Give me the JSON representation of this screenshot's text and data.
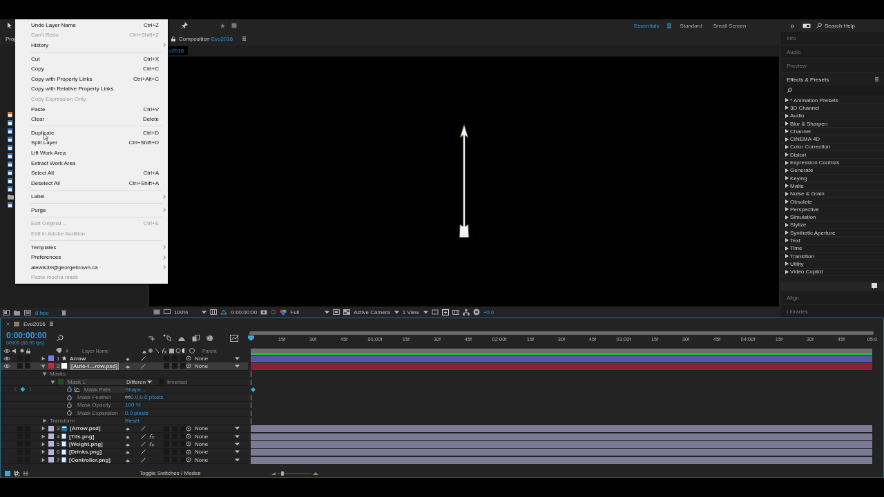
{
  "toolbar": {
    "workspaces": [
      {
        "label": "Essentials",
        "selected": true
      },
      {
        "label": "Standard",
        "selected": false
      },
      {
        "label": "Small Screen",
        "selected": false
      }
    ],
    "overflow": "»",
    "search_placeholder": "Search Help"
  },
  "project_panel": {
    "tab": "Proj",
    "bit_depth": "8 bpc"
  },
  "composition_panel": {
    "title": "Composition",
    "comp_name": "Evo2016",
    "tab": "o2016",
    "zoom": "100%",
    "timecode": "0:00:00:00",
    "resolution": "Full",
    "camera": "Active Camera",
    "views": "1 View",
    "exposure": "+0.0"
  },
  "side_panels": {
    "collapsed_top": [
      "Info",
      "Audio",
      "Preview"
    ],
    "effects": {
      "title": "Effects & Presets",
      "items": [
        "* Animation Presets",
        "3D Channel",
        "Audio",
        "Blur & Sharpen",
        "Channel",
        "CINEMA 4D",
        "Color Correction",
        "Distort",
        "Expression Controls",
        "Generate",
        "Keying",
        "Matte",
        "Noise & Grain",
        "Obsolete",
        "Perspective",
        "Simulation",
        "Stylize",
        "Synthetic Aperture",
        "Text",
        "Time",
        "Transition",
        "Utility",
        "Video Copilot"
      ]
    },
    "collapsed_bottom": [
      "Align",
      "Libraries"
    ]
  },
  "timeline": {
    "tab": "Evo2016",
    "timecode": "0:00:00:00",
    "frame_info": "00000 (60.00 fps)",
    "columns": {
      "number": "#",
      "layer_name": "Layer Name",
      "parent": "Parent"
    },
    "ruler": [
      "15f",
      "30f",
      "45f",
      "01:00f",
      "15f",
      "30f",
      "45f",
      "02:00f",
      "15f",
      "30f",
      "45f",
      "03:00f",
      "15f",
      "30f",
      "45f",
      "04:00f",
      "15f",
      "30f",
      "45f",
      "05:0"
    ],
    "layers": [
      {
        "number": "1",
        "name": "Arrow",
        "kind": "shape",
        "color": "#7b7bea",
        "visible": true,
        "selected": false,
        "expanded": false,
        "fx": false,
        "parent": "None"
      },
      {
        "number": "2",
        "name": "[Auto-t…row.psd]",
        "kind": "solid",
        "color": "#c8283a",
        "visible": true,
        "selected": true,
        "expanded": true,
        "fx": false,
        "parent": "None",
        "children": [
          {
            "label": "Masks",
            "expanded": true,
            "children": [
              {
                "label": "Mask 1",
                "kind": "mask",
                "expanded": true,
                "mode": "Differen",
                "inverted": {
                  "label": "Inverted",
                  "checked": false
                },
                "children": [
                  {
                    "label": "Mask Path",
                    "kind": "path",
                    "value": "Shape...",
                    "keyframed": true
                  },
                  {
                    "label": "Mask Feather",
                    "kind": "feather",
                    "value": "0.0,0.0 pixels",
                    "keyframed": false
                  },
                  {
                    "label": "Mask Opacity",
                    "kind": "property",
                    "value": "100 %",
                    "keyframed": false
                  },
                  {
                    "label": "Mask Expansion",
                    "kind": "property",
                    "value": "0.0 pixels",
                    "keyframed": false
                  }
                ]
              }
            ]
          },
          {
            "label": "Transform",
            "expanded": false,
            "value": "Reset"
          }
        ]
      },
      {
        "number": "3",
        "name": "[Arrow.psd]",
        "kind": "psd",
        "color": "#b9b4da",
        "visible": false,
        "selected": false,
        "expanded": false,
        "fx": false,
        "parent": "None"
      },
      {
        "number": "4",
        "name": "[Tits.png]",
        "kind": "image",
        "color": "#b9b4da",
        "visible": false,
        "selected": false,
        "expanded": false,
        "fx": true,
        "parent": "None"
      },
      {
        "number": "5",
        "name": "[Weight.png]",
        "kind": "image",
        "color": "#b9b4da",
        "visible": false,
        "selected": false,
        "expanded": false,
        "fx": true,
        "parent": "None"
      },
      {
        "number": "6",
        "name": "[Drinks.png]",
        "kind": "image",
        "color": "#b9b4da",
        "visible": false,
        "selected": false,
        "expanded": false,
        "fx": false,
        "parent": "None"
      },
      {
        "number": "7",
        "name": "[Controller.png]",
        "kind": "image",
        "color": "#b9b4da",
        "visible": false,
        "selected": false,
        "expanded": false,
        "fx": false,
        "parent": "None"
      }
    ],
    "footer": "Toggle Switches / Modes"
  },
  "context_menu": {
    "groups": [
      [
        {
          "label": "Undo Layer Name",
          "shortcut": "Ctrl+Z",
          "disabled": false,
          "submenu": false
        },
        {
          "label": "Can't Redo",
          "shortcut": "Ctrl+Shift+Z",
          "disabled": true,
          "submenu": false
        },
        {
          "label": "History",
          "disabled": false,
          "submenu": true
        }
      ],
      [
        {
          "label": "Cut",
          "shortcut": "Ctrl+X",
          "disabled": false,
          "submenu": false
        },
        {
          "label": "Copy",
          "shortcut": "Ctrl+C",
          "disabled": false,
          "submenu": false
        },
        {
          "label": "Copy with Property Links",
          "shortcut": "Ctrl+Alt+C",
          "disabled": false,
          "submenu": false
        },
        {
          "label": "Copy with Relative Property Links",
          "disabled": false,
          "submenu": false
        },
        {
          "label": "Copy Expression Only",
          "disabled": true,
          "submenu": false
        },
        {
          "label": "Paste",
          "shortcut": "Ctrl+V",
          "disabled": false,
          "submenu": false
        },
        {
          "label": "Clear",
          "shortcut": "Delete",
          "disabled": false,
          "submenu": false
        }
      ],
      [
        {
          "label": "Duplicate",
          "shortcut": "Ctrl+D",
          "disabled": false,
          "submenu": false
        },
        {
          "label": "Split Layer",
          "shortcut": "Ctrl+Shift+D",
          "disabled": false,
          "submenu": false
        },
        {
          "label": "Lift Work Area",
          "disabled": false,
          "submenu": false
        },
        {
          "label": "Extract Work Area",
          "disabled": false,
          "submenu": false
        },
        {
          "label": "Select All",
          "shortcut": "Ctrl+A",
          "disabled": false,
          "submenu": false
        },
        {
          "label": "Deselect All",
          "shortcut": "Ctrl+Shift+A",
          "disabled": false,
          "submenu": false
        }
      ],
      [
        {
          "label": "Label",
          "disabled": false,
          "submenu": true
        }
      ],
      [
        {
          "label": "Purge",
          "disabled": false,
          "submenu": true
        }
      ],
      [
        {
          "label": "Edit Original...",
          "shortcut": "Ctrl+E",
          "disabled": true,
          "submenu": false
        },
        {
          "label": "Edit in Adobe Audition",
          "disabled": true,
          "submenu": false
        }
      ],
      [
        {
          "label": "Templates",
          "disabled": false,
          "submenu": true
        },
        {
          "label": "Preferences",
          "disabled": false,
          "submenu": true
        },
        {
          "label": "alewis39@georgebrown.ca",
          "disabled": false,
          "submenu": true
        },
        {
          "label": "Paste mocha mask",
          "disabled": true,
          "submenu": false
        }
      ]
    ]
  }
}
